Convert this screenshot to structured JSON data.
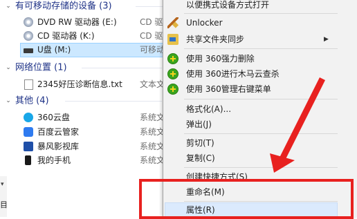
{
  "explorer": {
    "groups": [
      {
        "header": "有可移动存储的设备 (3)",
        "chevron": "⌄",
        "items": [
          {
            "name": "DVD RW 驱动器 (E:)",
            "type": "CD 驱",
            "icon": "dvd-drive-icon"
          },
          {
            "name": "CD 驱动器 (K:)",
            "type": "CD 驱",
            "icon": "cd-drive-icon"
          },
          {
            "name": "U盘 (M:)",
            "type": "可移动",
            "icon": "usb-drive-icon",
            "selected": true
          }
        ]
      },
      {
        "header": "网络位置 (1)",
        "chevron": "⌄",
        "items": [
          {
            "name": "2345好压诊断信息.txt",
            "type": "文本文",
            "icon": "text-file-icon"
          }
        ]
      },
      {
        "header": "其他 (4)",
        "chevron": "⌄",
        "items": [
          {
            "name": "360云盘",
            "type": "系统文",
            "icon": "360-cloud-icon"
          },
          {
            "name": "百度云管家",
            "type": "系统文",
            "icon": "baidu-cloud-icon"
          },
          {
            "name": "暴风影视库",
            "type": "系统文",
            "icon": "baofeng-icon"
          },
          {
            "name": "我的手机",
            "type": "系统文",
            "icon": "phone-icon"
          }
        ]
      }
    ],
    "status_text": "目"
  },
  "context_menu": {
    "items": [
      {
        "label": "以便携式设备方式打开"
      },
      {
        "label": "Unlocker",
        "icon": "broom-icon"
      },
      {
        "label": "共享文件夹同步",
        "icon": "sync-folder-icon",
        "submenu_arrow": "▶"
      },
      {
        "label": "使用 360强力删除",
        "icon": "360-delete-icon"
      },
      {
        "label": "使用 360进行木马云查杀",
        "icon": "360-trojan-scan-icon"
      },
      {
        "label": "使用 360管理右键菜单",
        "icon": "360-menu-manager-icon"
      },
      {
        "label": "格式化(A)..."
      },
      {
        "label": "弹出(J)"
      },
      {
        "label": "剪切(T)"
      },
      {
        "label": "复制(C)"
      },
      {
        "label": "创建快捷方式(S)"
      },
      {
        "label": "重命名(M)"
      },
      {
        "label": "属性(R)",
        "highlighted": true
      }
    ]
  },
  "annotation": {
    "box_color": "#e8211f",
    "arrow_color": "#e8211f"
  },
  "colors": {
    "group_header": "#1e3287",
    "selection": "#cce8ff",
    "menu_bg": "#f2f2f2",
    "menu_hover": "#dbeafd"
  }
}
